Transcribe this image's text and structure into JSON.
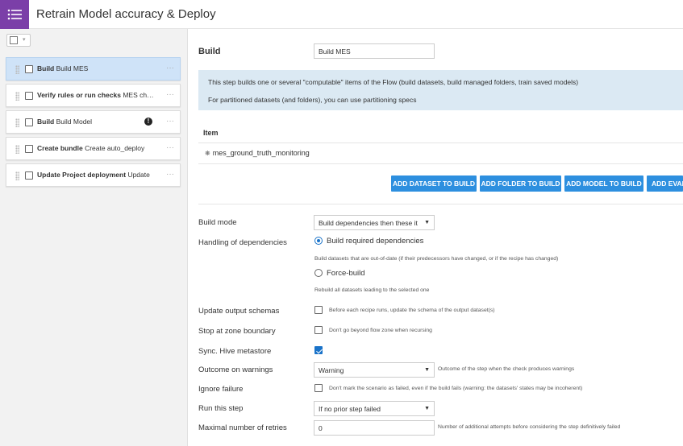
{
  "header": {
    "title": "Retrain Model accuracy & Deploy",
    "menu_icon": "list-menu-icon",
    "accent_color": "#7b3fa8"
  },
  "sidebar": {
    "steps": [
      {
        "type": "Build",
        "name": "Build MES",
        "active": true,
        "warning": false
      },
      {
        "type": "Verify rules or run checks",
        "name": "MES check",
        "active": false,
        "warning": false
      },
      {
        "type": "Build",
        "name": "Build Model",
        "active": false,
        "warning": true
      },
      {
        "type": "Create bundle",
        "name": "Create auto_deploy",
        "active": false,
        "warning": false
      },
      {
        "type": "Update Project deployment",
        "name": "Update",
        "active": false,
        "warning": false
      }
    ]
  },
  "step_editor": {
    "section_title": "Build",
    "step_name": "Build MES",
    "info_line1": "This step builds one or several \"computable\" items of the Flow (build datasets, build managed folders, train saved models)",
    "info_line2": "For partitioned datasets (and folders), you can use partitioning specs",
    "item_header": "Item",
    "items": [
      "mes_ground_truth_monitoring"
    ],
    "buttons": {
      "add_dataset": "ADD DATASET TO BUILD",
      "add_folder": "ADD FOLDER TO BUILD",
      "add_model": "ADD MODEL TO BUILD",
      "add_eval": "ADD EVAL"
    },
    "build_mode": {
      "label": "Build mode",
      "value": "Build dependencies then these it"
    },
    "dependencies": {
      "label": "Handling of dependencies",
      "option1": "Build required dependencies",
      "option1_hint": "Build datasets that are out-of-date (if their predecessors have changed, or if the recipe has changed)",
      "option2": "Force-build",
      "option2_hint": "Rebuild all datasets leading to the selected one",
      "selected": "Build required dependencies"
    },
    "update_schemas": {
      "label": "Update output schemas",
      "hint": "Before each recipe runs, update the schema of the output dataset(s)",
      "checked": false
    },
    "stop_zone": {
      "label": "Stop at zone boundary",
      "hint": "Don't go beyond flow zone when recursing",
      "checked": false
    },
    "hive_sync": {
      "label": "Sync. Hive metastore",
      "checked": true
    },
    "outcome_warnings": {
      "label": "Outcome on warnings",
      "value": "Warning",
      "hint": "Outcome of the step when the check produces warnings"
    },
    "ignore_failure": {
      "label": "Ignore failure",
      "hint": "Don't mark the scenario as failed, even if the build fails (warning: the datasets' states may be incoherent)",
      "checked": false
    },
    "run_step": {
      "label": "Run this step",
      "value": "If no prior step failed"
    },
    "max_retries": {
      "label": "Maximal number of retries",
      "value": "0",
      "hint": "Number of additional attempts before considering the step definitively failed"
    }
  }
}
